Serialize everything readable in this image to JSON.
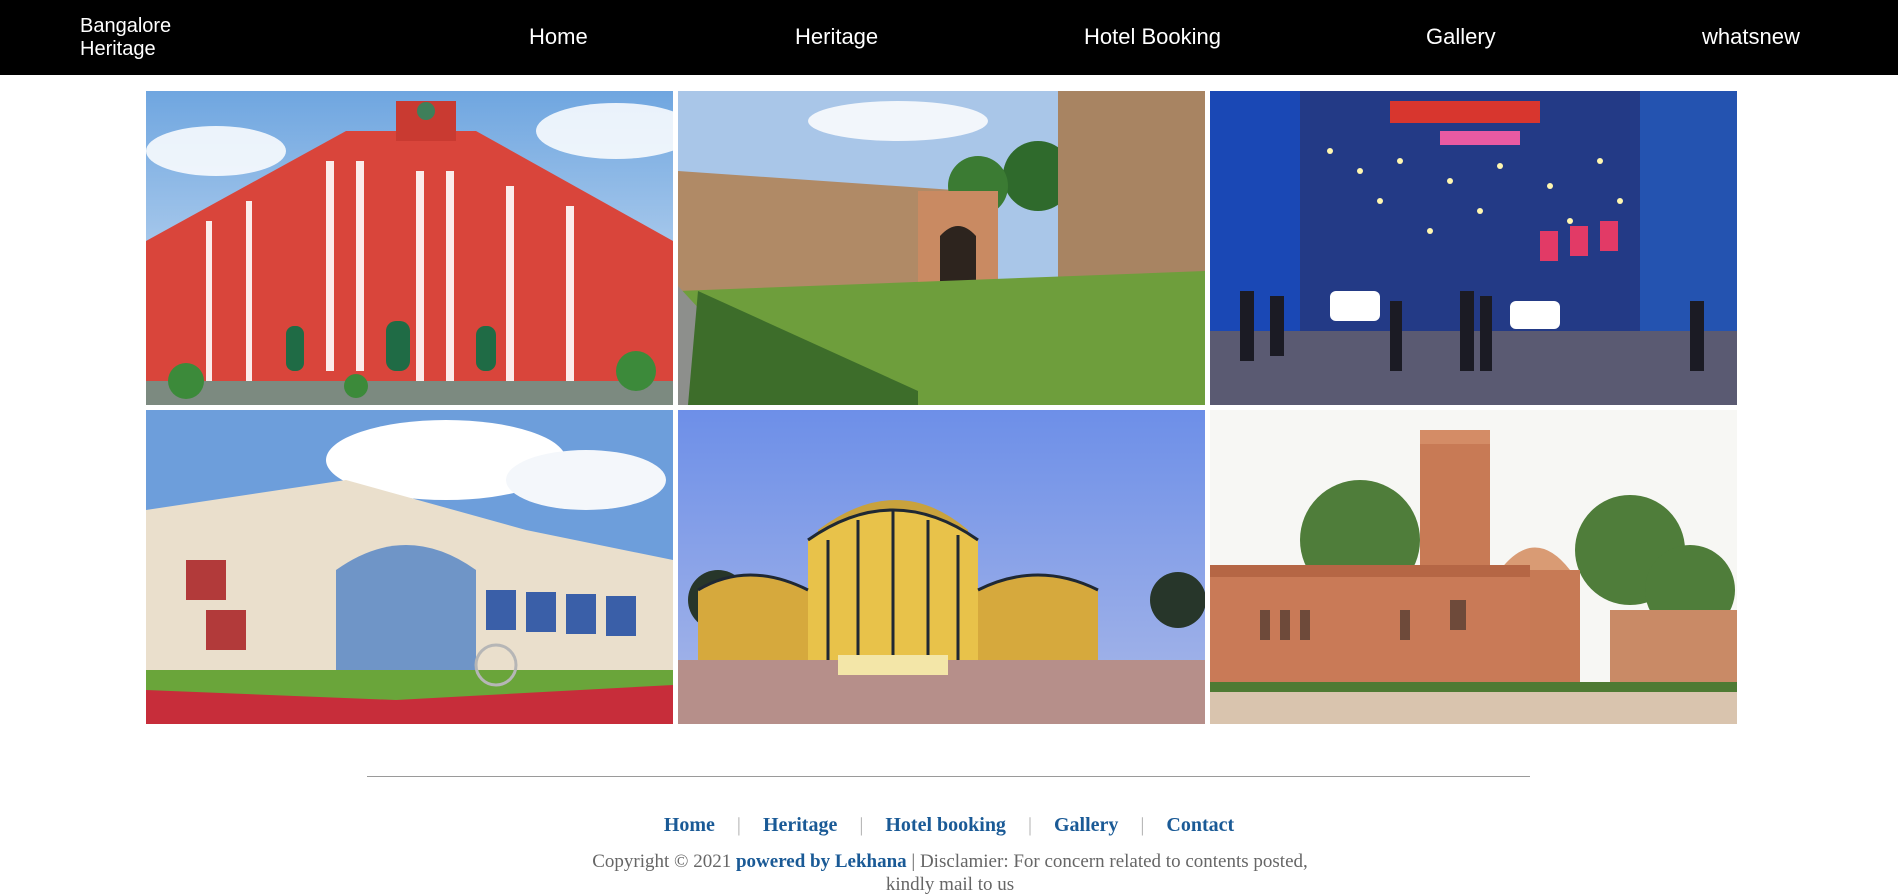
{
  "navbar": {
    "brand_line1": "Bangalore",
    "brand_line2": "Heritage",
    "links": [
      "Home",
      "Heritage",
      "Hotel Booking",
      "Gallery",
      "whatsnew"
    ],
    "background": "#000000"
  },
  "gallery": {
    "images": [
      {
        "subject": "red-building"
      },
      {
        "subject": "fort-gate"
      },
      {
        "subject": "street-lights"
      },
      {
        "subject": "ornate-arch"
      },
      {
        "subject": "glass-house"
      },
      {
        "subject": "stone-observatory"
      }
    ]
  },
  "footer": {
    "links": [
      "Home",
      "Heritage",
      "Hotel booking",
      "Gallery",
      "Contact"
    ],
    "separator": "|",
    "copyright_prefix": "Copyright © 2021",
    "powered_by": "powered by Lekhana",
    "disclaimer": "| Disclamier: For concern related to contents posted, kindly mail to us",
    "link_color": "#1a5a96"
  }
}
